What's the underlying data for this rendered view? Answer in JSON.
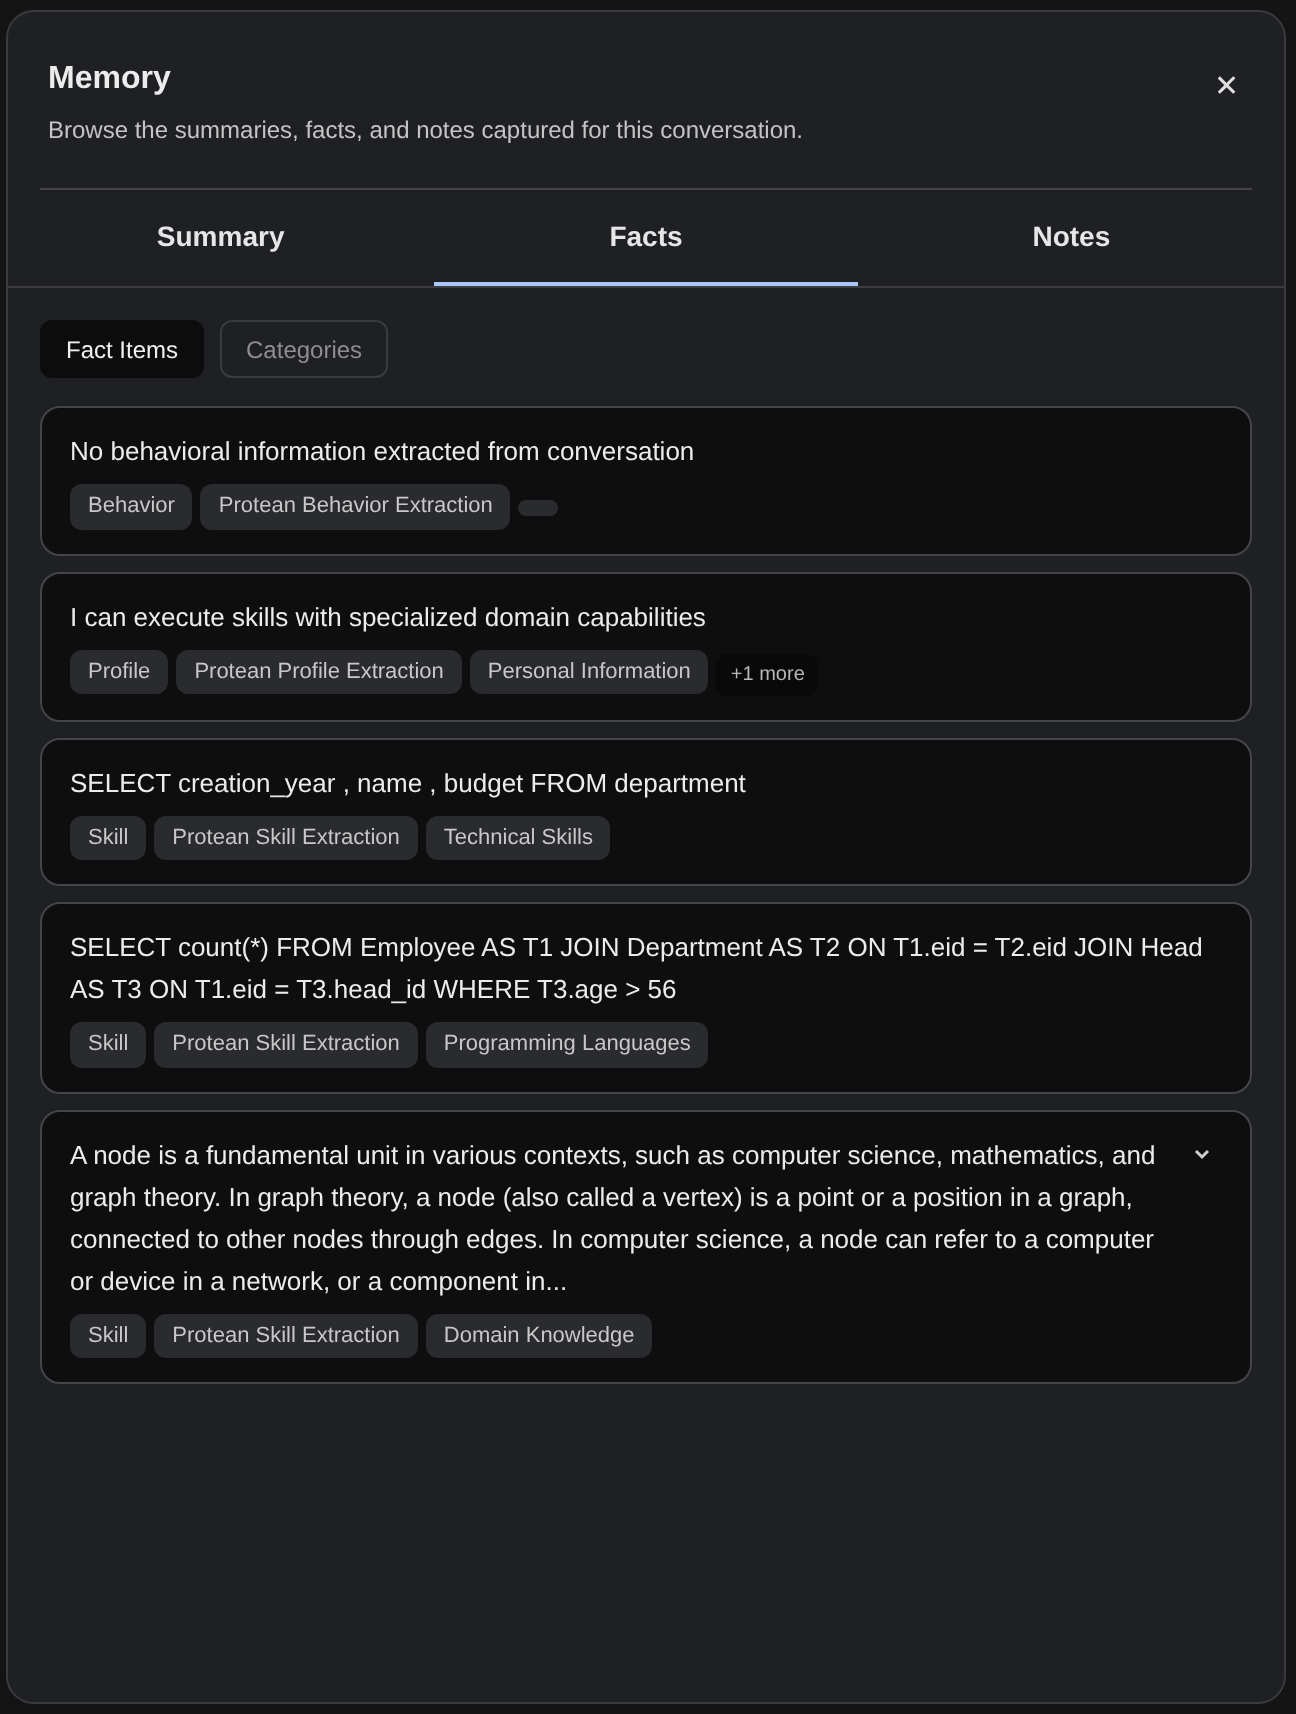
{
  "dialog": {
    "title": "Memory",
    "subtitle": "Browse the summaries, facts, and notes captured for this conversation.",
    "close": "✕"
  },
  "tabs": [
    {
      "label": "Summary",
      "selected": false
    },
    {
      "label": "Facts",
      "selected": true
    },
    {
      "label": "Notes",
      "selected": false
    }
  ],
  "view_toggle": [
    {
      "label": "Fact Items",
      "selected": true
    },
    {
      "label": "Categories",
      "selected": false
    }
  ],
  "facts": [
    {
      "text": "No behavioral information extracted from conversation",
      "expandable": false,
      "blank_tag": true,
      "tags": [
        {
          "kind": "tag",
          "label": "Behavior"
        },
        {
          "kind": "tag",
          "label": "Protean Behavior Extraction"
        }
      ]
    },
    {
      "text": "I can execute skills with specialized domain capabilities",
      "expandable": false,
      "blank_tag": false,
      "tags": [
        {
          "kind": "tag",
          "label": "Profile"
        },
        {
          "kind": "tag",
          "label": "Protean Profile Extraction"
        },
        {
          "kind": "tag",
          "label": "Personal Information"
        },
        {
          "kind": "more",
          "label": "+1 more"
        }
      ]
    },
    {
      "text": "SELECT creation_year , name , budget FROM department",
      "expandable": false,
      "blank_tag": false,
      "tags": [
        {
          "kind": "tag",
          "label": "Skill"
        },
        {
          "kind": "tag",
          "label": "Protean Skill Extraction"
        },
        {
          "kind": "tag",
          "label": "Technical Skills"
        }
      ]
    },
    {
      "text": "SELECT count(*) FROM Employee AS T1 JOIN Department AS T2 ON T1.eid = T2.eid JOIN Head AS T3 ON T1.eid = T3.head_id WHERE T3.age > 56",
      "expandable": false,
      "blank_tag": false,
      "tags": [
        {
          "kind": "tag",
          "label": "Skill"
        },
        {
          "kind": "tag",
          "label": "Protean Skill Extraction"
        },
        {
          "kind": "tag",
          "label": "Programming Languages"
        }
      ]
    },
    {
      "text": "A node is a fundamental unit in various contexts, such as computer science, mathematics, and graph theory. In graph theory, a node (also called a vertex) is a point or a position in a graph, connected to other nodes through edges. In computer science, a node can refer to a computer or device in a network, or a component in...",
      "expandable": true,
      "blank_tag": false,
      "tags": [
        {
          "kind": "tag",
          "label": "Skill"
        },
        {
          "kind": "tag",
          "label": "Protean Skill Extraction"
        },
        {
          "kind": "tag",
          "label": "Domain Knowledge"
        }
      ]
    }
  ]
}
